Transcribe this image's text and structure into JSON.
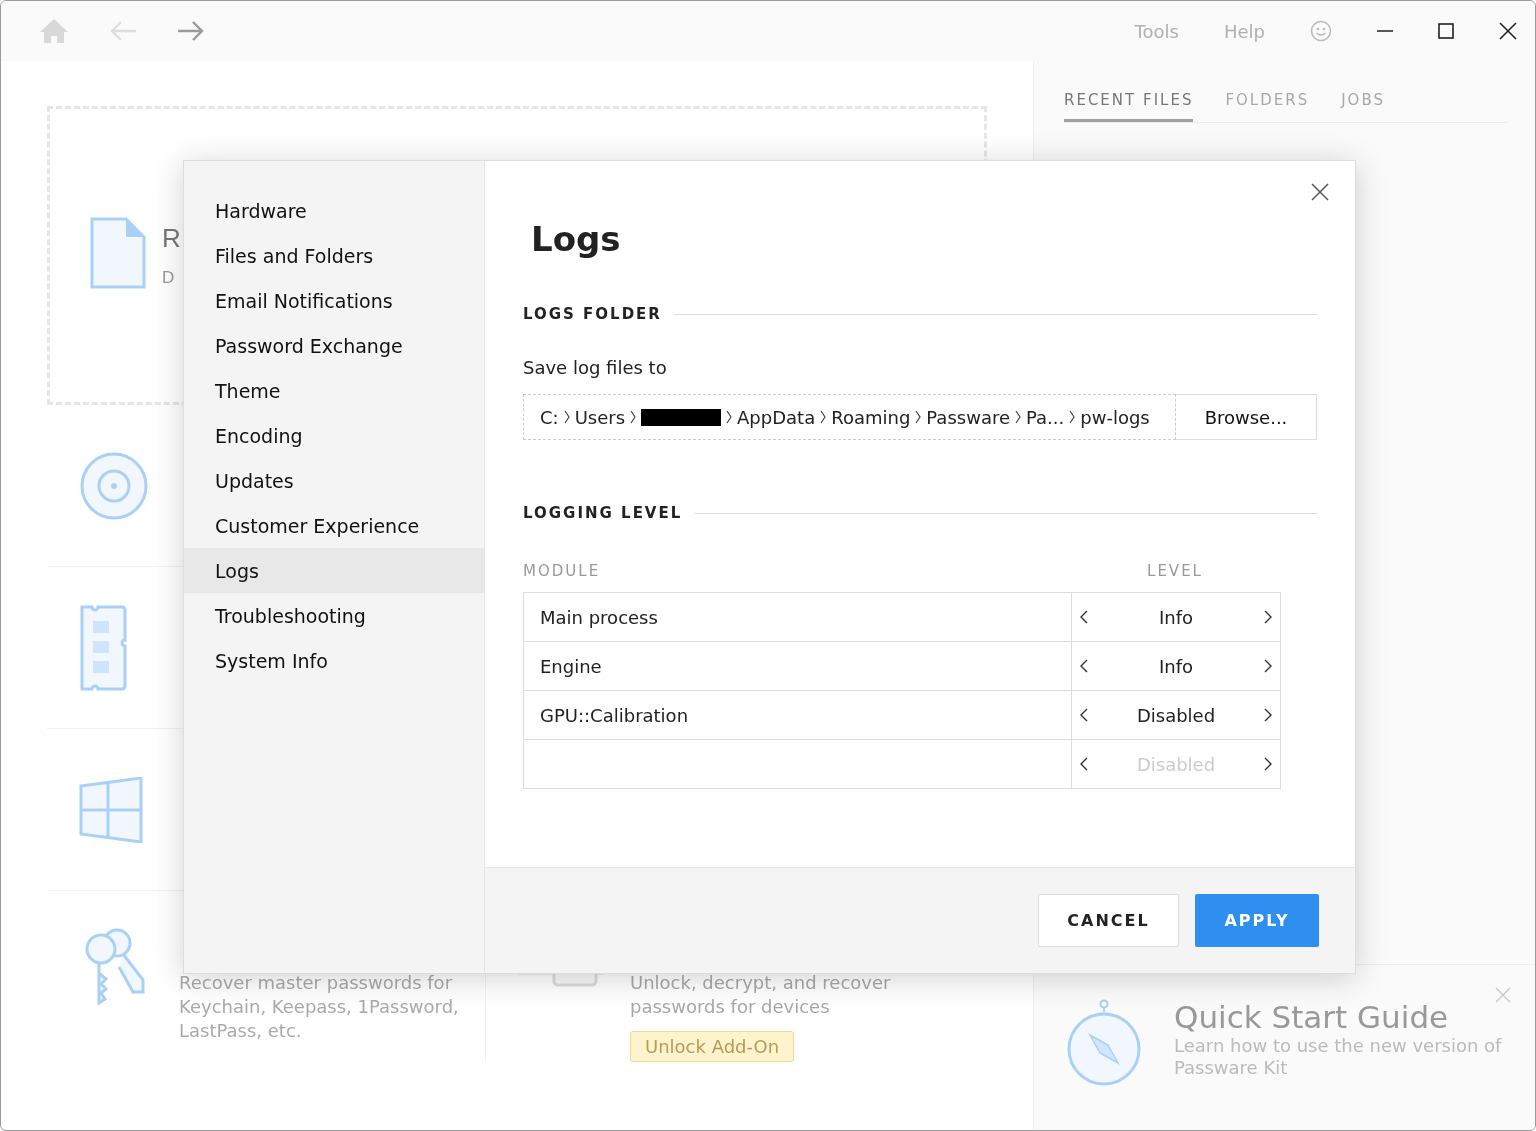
{
  "toolbar": {
    "menu": [
      "Tools",
      "Help"
    ]
  },
  "background": {
    "drop_area": {
      "title": "R",
      "description": "D"
    },
    "bottom_cards": [
      {
        "description": [
          "Recover master passwords for",
          "Keychain, Keepass, 1Password,",
          "LastPass, etc."
        ],
        "locked": false
      },
      {
        "description": [
          "Unlock, decrypt, and recover",
          "passwords for devices"
        ],
        "locked": true,
        "button": "Unlock Add-On"
      }
    ]
  },
  "side_panel": {
    "tabs": [
      {
        "label": "RECENT FILES",
        "selected": true
      },
      {
        "label": "FOLDERS",
        "selected": false
      },
      {
        "label": "JOBS",
        "selected": false
      }
    ],
    "quick_start": {
      "title": "Quick Start Guide",
      "description": [
        "Learn how to use the new version of",
        "Passware Kit"
      ]
    }
  },
  "dialog": {
    "nav": [
      {
        "label": "Hardware",
        "selected": false
      },
      {
        "label": "Files and Folders",
        "selected": false
      },
      {
        "label": "Email Notifications",
        "selected": false
      },
      {
        "label": "Password Exchange",
        "selected": false
      },
      {
        "label": "Theme",
        "selected": false
      },
      {
        "label": "Encoding",
        "selected": false
      },
      {
        "label": "Updates",
        "selected": false
      },
      {
        "label": "Customer Experience",
        "selected": false
      },
      {
        "label": "Logs",
        "selected": true
      },
      {
        "label": "Troubleshooting",
        "selected": false
      },
      {
        "label": "System Info",
        "selected": false
      }
    ],
    "title": "Logs",
    "logs_folder": {
      "heading": "LOGS FOLDER",
      "label": "Save log files to",
      "path": [
        {
          "kind": "text",
          "text": "C:"
        },
        {
          "kind": "text",
          "text": "Users"
        },
        {
          "kind": "redacted"
        },
        {
          "kind": "text",
          "text": "AppData"
        },
        {
          "kind": "text",
          "text": "Roaming"
        },
        {
          "kind": "text",
          "text": "Passware"
        },
        {
          "kind": "text",
          "text": "Pa..."
        },
        {
          "kind": "text",
          "text": "pw-logs"
        }
      ],
      "browse_button": "Browse..."
    },
    "logging_level": {
      "heading": "LOGGING LEVEL",
      "columns": [
        "MODULE",
        "LEVEL"
      ],
      "rows": [
        {
          "module": "Main process",
          "level": "Info",
          "disabled": false
        },
        {
          "module": "Engine",
          "level": "Info",
          "disabled": false
        },
        {
          "module": "GPU::Calibration",
          "level": "Disabled",
          "disabled": false
        },
        {
          "level": "Disabled",
          "disabled": true
        }
      ]
    },
    "buttons": [
      {
        "label": "CANCEL",
        "kind": "secondary"
      },
      {
        "label": "APPLY",
        "kind": "primary"
      }
    ]
  }
}
